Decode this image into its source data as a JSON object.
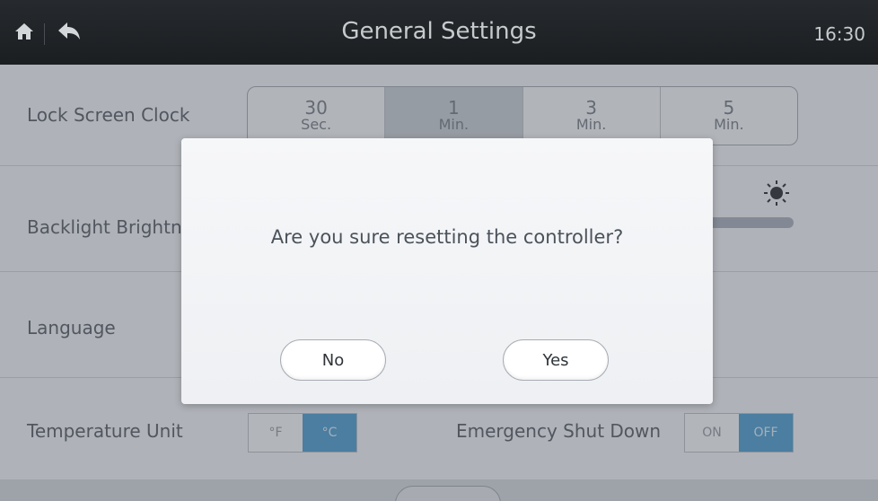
{
  "header": {
    "title": "General Settings",
    "clock": "16:30",
    "home_icon": "home-icon",
    "back_icon": "back-icon"
  },
  "settings": {
    "lock_screen_clock": {
      "label": "Lock Screen Clock",
      "options": [
        {
          "num": "30",
          "unit": "Sec."
        },
        {
          "num": "1",
          "unit": "Min."
        },
        {
          "num": "3",
          "unit": "Min."
        },
        {
          "num": "5",
          "unit": "Min."
        }
      ],
      "selected": "1 Min."
    },
    "backlight": {
      "label": "Backlight Brightn",
      "icon": "sun-icon"
    },
    "language": {
      "label": "Language"
    },
    "temperature_unit": {
      "label": "Temperature Unit",
      "option_f": "°F",
      "option_c": "°C",
      "selected": "°C"
    },
    "emergency_shut_down": {
      "label": "Emergency Shut Down",
      "option_on": "ON",
      "option_off": "OFF",
      "selected": "OFF"
    }
  },
  "dialog": {
    "message": "Are you sure resetting the controller?",
    "no_label": "No",
    "yes_label": "Yes"
  },
  "colors": {
    "header_bg": "#1f2226",
    "accent": "#4194c8",
    "overlay": "#5a6068"
  }
}
